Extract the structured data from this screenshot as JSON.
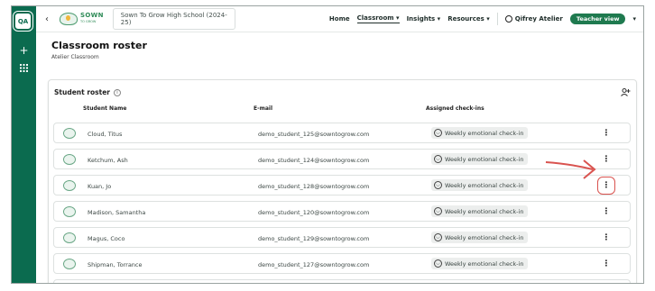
{
  "rail": {
    "avatar_label": "QA"
  },
  "topbar": {
    "logo_main": "SOWN",
    "logo_sub": "TO GROW",
    "school": "Sown To Grow High School (2024-25)",
    "nav": [
      {
        "label": "Home"
      },
      {
        "label": "Classroom ▾"
      },
      {
        "label": "Insights ▾"
      },
      {
        "label": "Resources ▾"
      }
    ],
    "user_name": "Qifrey Atelier",
    "teacher_view": "Teacher view"
  },
  "page": {
    "title": "Classroom roster",
    "subtitle": "Atelier Classroom"
  },
  "roster": {
    "heading": "Student roster",
    "columns": {
      "name": "Student Name",
      "email": "E-mail",
      "checkins": "Assigned check-ins"
    },
    "rows": [
      {
        "name": "Cloud, Titus",
        "email": "demo_student_125@sowntogrow.com",
        "checkin": "Weekly emotional check-in"
      },
      {
        "name": "Ketchum, Ash",
        "email": "demo_student_124@sowntogrow.com",
        "checkin": "Weekly emotional check-in"
      },
      {
        "name": "Kuan, Jo",
        "email": "demo_student_128@sowntogrow.com",
        "checkin": "Weekly emotional check-in"
      },
      {
        "name": "Madison, Samantha",
        "email": "demo_student_120@sowntogrow.com",
        "checkin": "Weekly emotional check-in"
      },
      {
        "name": "Magus, Coco",
        "email": "demo_student_129@sowntogrow.com",
        "checkin": "Weekly emotional check-in"
      },
      {
        "name": "Shipman, Torrance",
        "email": "demo_student_127@sowntogrow.com",
        "checkin": "Weekly emotional check-in"
      }
    ]
  },
  "colors": {
    "brand": "#0b6b4f",
    "annotation": "#d9534f"
  }
}
